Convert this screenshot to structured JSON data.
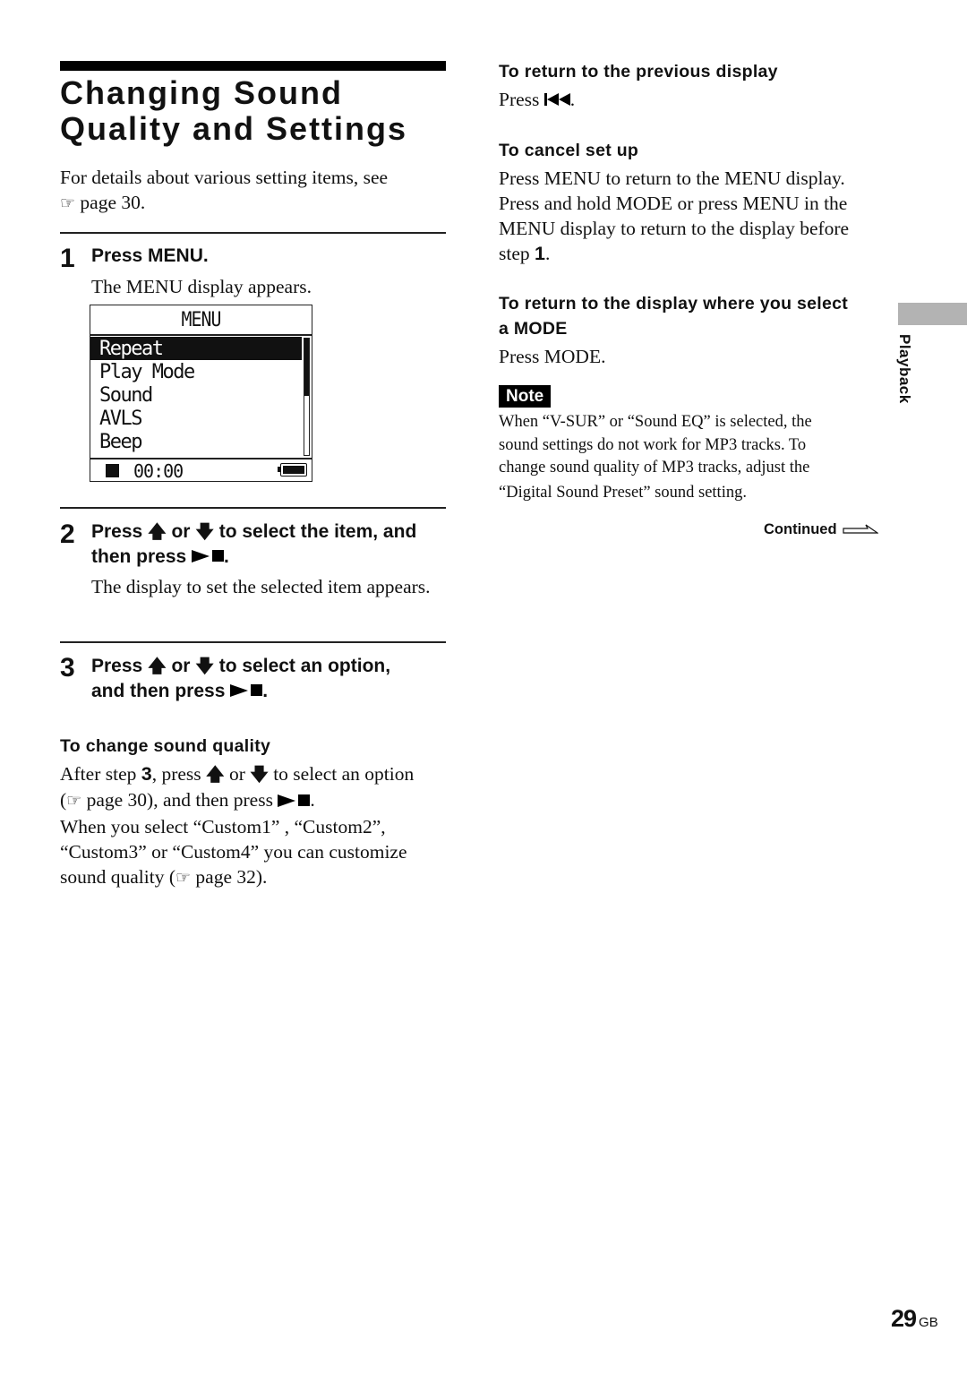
{
  "page": {
    "title_line1": "Changing Sound",
    "title_line2": "Quality and Settings",
    "intro_text": "For details about various setting items, see",
    "intro_ref": "page 30.",
    "section_tab_label": "Playback",
    "page_number": "29",
    "page_suffix": "GB",
    "continued_label": "Continued"
  },
  "steps": [
    {
      "number": "1",
      "head": "Press MENU.",
      "body": "The MENU display appears."
    },
    {
      "number": "2",
      "head_part1": "Press",
      "head_or": "or",
      "head_part2": "to select the item, and",
      "head_line2": "then press",
      "body": "The display to set the selected item appears."
    },
    {
      "number": "3",
      "head_part1": "Press",
      "head_or": "or",
      "head_part2": "to select an option,",
      "head_line2": "and then press"
    }
  ],
  "lcd": {
    "title": "MENU",
    "items": [
      "Repeat",
      "Play Mode",
      "Sound",
      "AVLS",
      "Beep"
    ],
    "selected_index": 0,
    "time": "00:00",
    "scroll_position_fraction": 0.5,
    "battery_level": "full"
  },
  "icons": {
    "pointer": "☞",
    "up_arrow": "🡅",
    "down_arrow": "🡇"
  },
  "sound_quality": {
    "heading": "To change sound quality",
    "line1_a": "After step",
    "line1_step": "3",
    "line1_b": ", press",
    "line1_or": "or",
    "line1_c": "to select an option",
    "line2_a": "(",
    "line2_b": "page 30), and then press",
    "line3": "When you select “Custom1” , “Custom2”,",
    "line4": "“Custom3” or “Custom4” you can customize",
    "line5_a": "sound quality (",
    "line5_b": "page 32)."
  },
  "right_column": {
    "prev_heading": "To return to the previous display",
    "prev_body": "Press",
    "cancel_heading": "To cancel set up",
    "cancel_line1": "Press MENU to return to the MENU display.",
    "cancel_line2": "Press and hold MODE or press MENU in the",
    "cancel_line3": "MENU display to return to the display before",
    "cancel_line4_a": "step",
    "cancel_line4_step": "1",
    "mode_heading_line1": "To return to the display where you select",
    "mode_heading_line2": "a MODE",
    "mode_body": "Press MODE.",
    "note_label": "Note",
    "note_line1": "When “V-SUR” or “Sound EQ” is selected, the",
    "note_line2": "sound settings do not work for MP3 tracks. To",
    "note_line3": "change sound quality of MP3 tracks, adjust the",
    "note_line4": "“Digital Sound Preset” sound setting."
  }
}
